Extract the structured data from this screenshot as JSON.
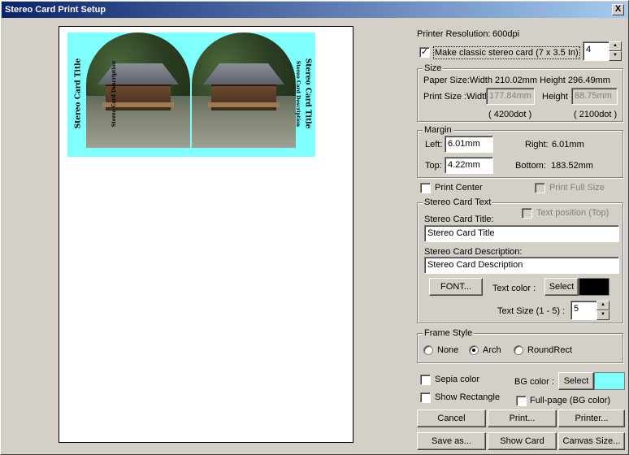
{
  "window": {
    "title": "Stereo Card Print Setup",
    "close_label": "X"
  },
  "preview": {
    "card_title": "Stereo Card Title",
    "card_description": "Stereo Card Description"
  },
  "printer": {
    "resolution_label": "Printer Resolution:",
    "resolution_value": "600dpi"
  },
  "classic": {
    "label": "Make classic stereo card (7 x 3.5 In)",
    "checked": true,
    "count": "4"
  },
  "size": {
    "group_label": "Size",
    "paper_size": "Paper Size:Width 210.02mm Height 296.49mm",
    "print_size_label": "Print Size :Width",
    "width_value": "177.84mm",
    "height_label": "Height",
    "height_value": "88.75mm",
    "width_dots": "( 4200dot )",
    "height_dots": "( 2100dot )"
  },
  "margin": {
    "group_label": "Margin",
    "left_label": "Left:",
    "left_value": "6.01mm",
    "right_label": "Right:",
    "right_value": "6.01mm",
    "top_label": "Top:",
    "top_value": "4.22mm",
    "bottom_label": "Bottom:",
    "bottom_value": "183.52mm"
  },
  "options": {
    "print_center": "Print Center",
    "print_full_size": "Print Full Size"
  },
  "card_text": {
    "group_label": "Stereo Card Text",
    "text_position": "Text position (Top)",
    "title_label": "Stereo Card Title:",
    "title_value": "Stereo Card Title",
    "desc_label": "Stereo Card Description:",
    "desc_value": "Stereo Card Description",
    "font_button": "FONT...",
    "text_color_label": "Text color :",
    "select_button": "Select",
    "text_color": "#000000",
    "text_size_label": "Text Size (1 - 5) :",
    "text_size_value": "5"
  },
  "frame": {
    "group_label": "Frame Style",
    "none": "None",
    "arch": "Arch",
    "roundrect": "RoundRect",
    "selected": "Arch"
  },
  "bg": {
    "sepia": "Sepia color",
    "show_rect": "Show Rectangle",
    "bg_color_label": "BG color :",
    "select_button": "Select",
    "bg_color": "#80ffff",
    "full_page": "Full-page (BG color)"
  },
  "buttons": {
    "cancel": "Cancel",
    "print": "Print...",
    "printer": "Printer...",
    "save_as": "Save as...",
    "show_card": "Show Card",
    "canvas_size": "Canvas Size..."
  }
}
